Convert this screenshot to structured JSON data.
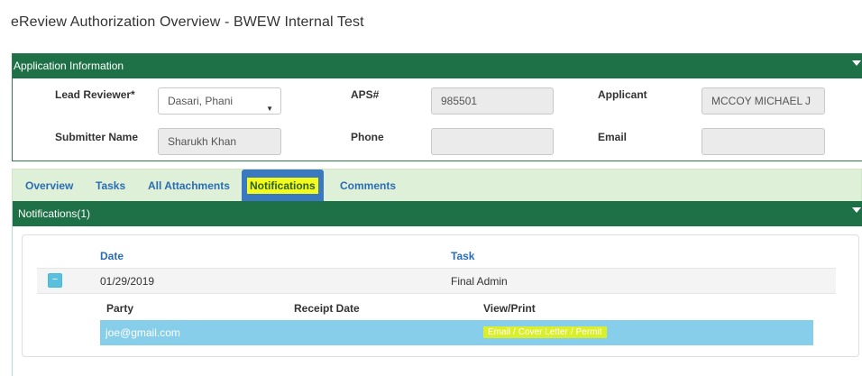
{
  "page": {
    "title": "eReview Authorization Overview - BWEW Internal Test"
  },
  "app_info": {
    "header": "Application Information",
    "lead_reviewer_label": "Lead Reviewer*",
    "lead_reviewer_value": "Dasari, Phani",
    "aps_label": "APS#",
    "aps_value": "985501",
    "applicant_label": "Applicant",
    "applicant_value": "MCCOY MICHAEL J",
    "submitter_label": "Submitter Name",
    "submitter_value": "Sharukh Khan",
    "phone_label": "Phone",
    "phone_value": "",
    "email_label": "Email",
    "email_value": ""
  },
  "tabs": [
    {
      "label": "Overview"
    },
    {
      "label": "Tasks"
    },
    {
      "label": "All Attachments"
    },
    {
      "label": "Notifications"
    },
    {
      "label": "Comments"
    }
  ],
  "notifications": {
    "header": "Notifications(1)",
    "columns": {
      "date": "Date",
      "task": "Task"
    },
    "rows": [
      {
        "toggle": "−",
        "date": "01/29/2019",
        "task": "Final Admin"
      }
    ],
    "sub_columns": {
      "party": "Party",
      "receipt_date": "Receipt Date",
      "view_print": "View/Print"
    },
    "sub_rows": [
      {
        "party": "joe@gmail.com",
        "receipt_date": "",
        "links": [
          "Email",
          "Cover Letter",
          "Permit"
        ],
        "separator": "/"
      }
    ]
  },
  "colors": {
    "header_green": "#1e7046",
    "tab_bar_bg": "#dff0d8",
    "tab_active": "#3a78c0",
    "highlight_yellow": "#f2fa1e",
    "sub_row_blue": "#87ceeb",
    "link_blue": "#2a6db5"
  }
}
